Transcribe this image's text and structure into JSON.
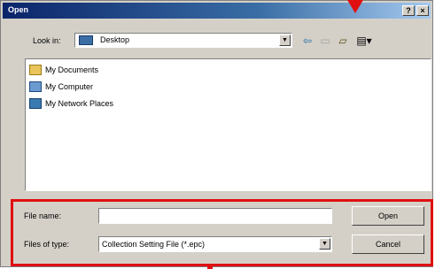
{
  "window": {
    "title": "Open",
    "help_label": "?",
    "close_label": "×"
  },
  "lookin": {
    "label": "Look in:",
    "value": "Desktop",
    "icon": "desktop-icon"
  },
  "toolbar": {
    "back_icon": "back-icon",
    "up_icon": "up-folder-icon",
    "new_folder_icon": "new-folder-icon",
    "views_icon": "views-menu-icon"
  },
  "files": [
    {
      "label": "My Documents",
      "icon": "folder-icon"
    },
    {
      "label": "My Computer",
      "icon": "computer-icon"
    },
    {
      "label": "My Network Places",
      "icon": "network-icon"
    }
  ],
  "bottom": {
    "filename_label": "File name:",
    "filename_value": "",
    "filetype_label": "Files of type:",
    "filetype_value": "Collection Setting File (*.epc)",
    "open_label": "Open",
    "cancel_label": "Cancel"
  },
  "colors": {
    "annotation": "#e01010",
    "title_start": "#0a246a",
    "title_end": "#a6caf0"
  }
}
